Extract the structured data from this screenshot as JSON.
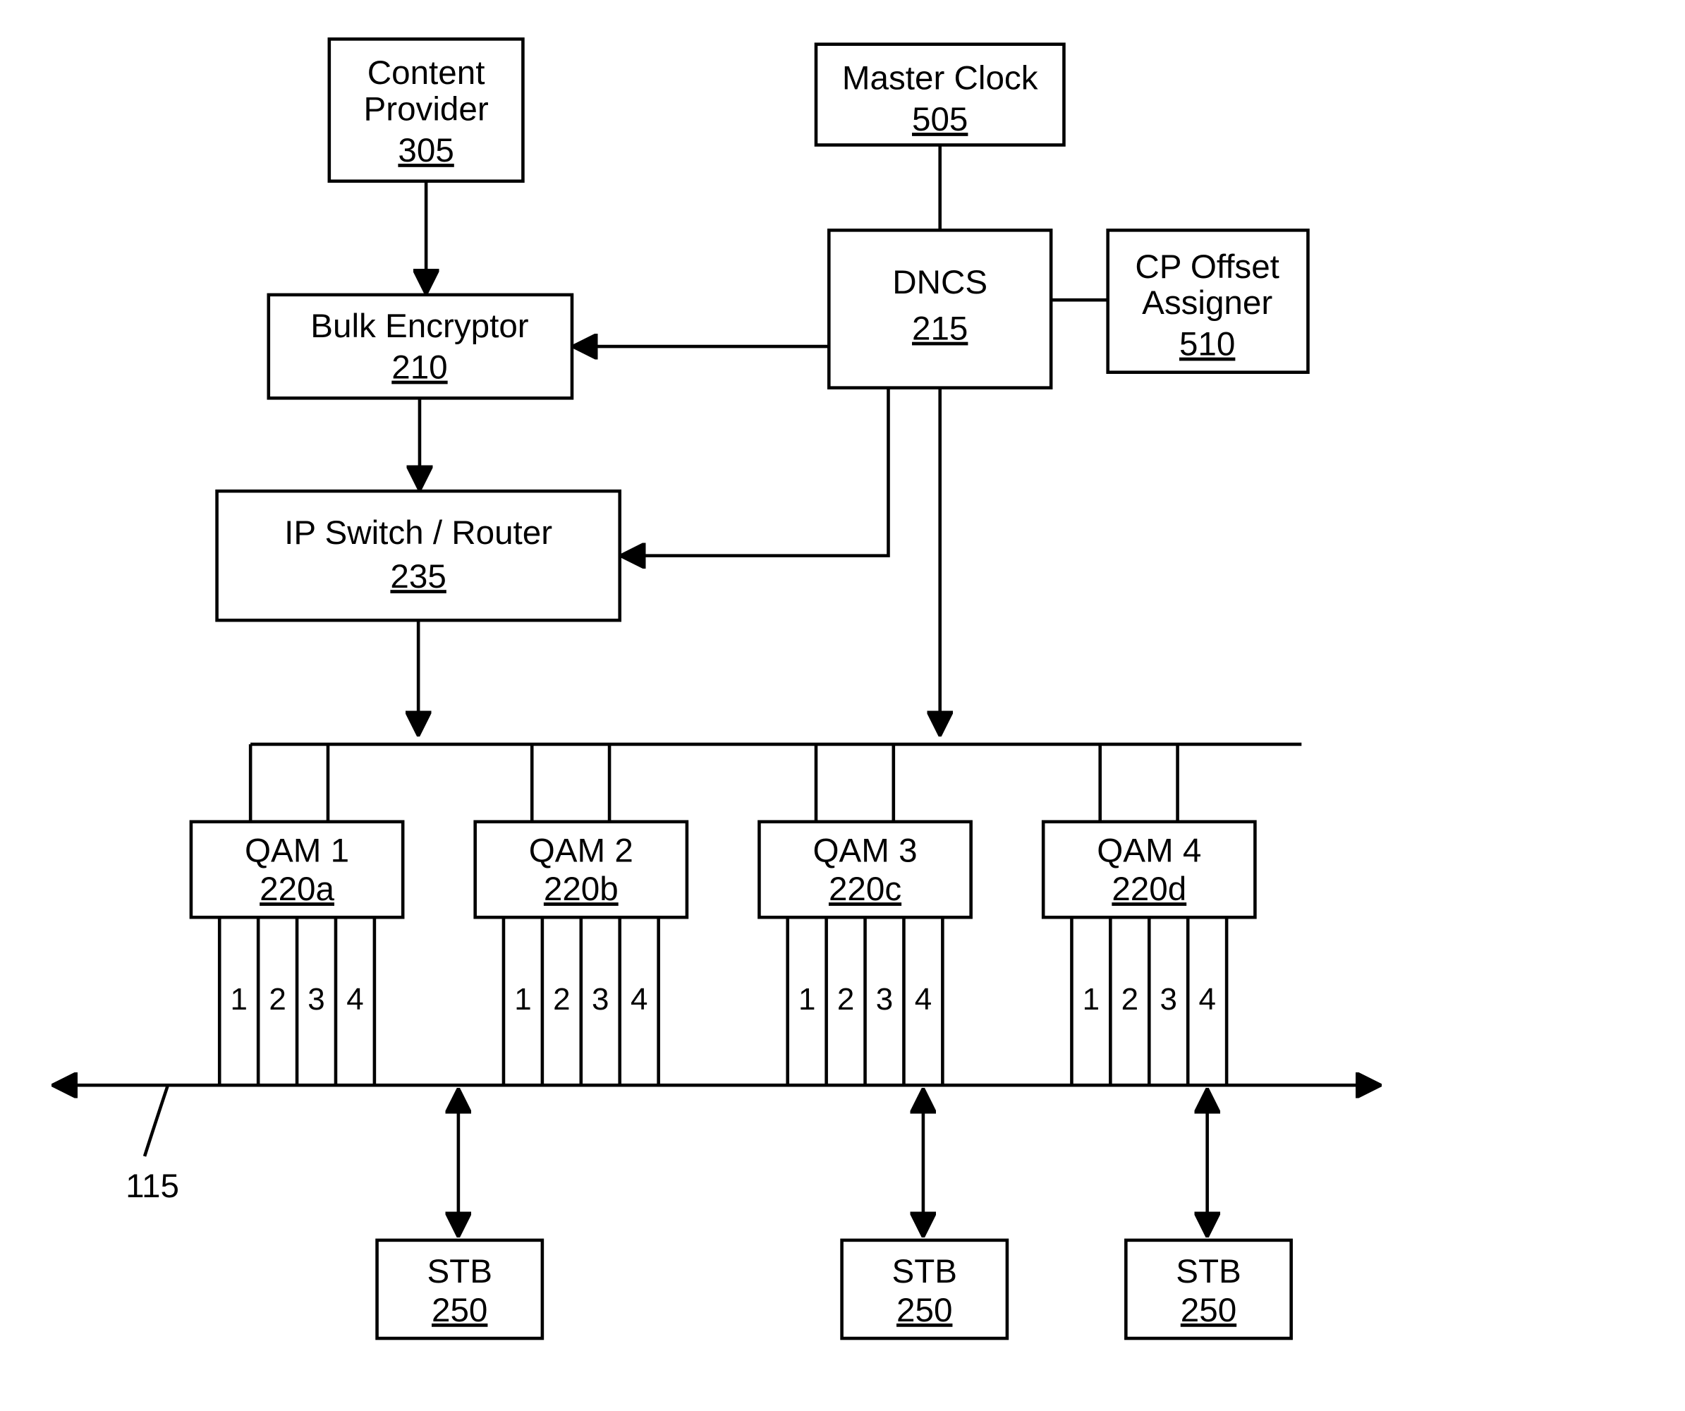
{
  "content_provider": {
    "label": "Content",
    "label2": "Provider",
    "ref": "305"
  },
  "master_clock": {
    "label": "Master Clock",
    "ref": "505"
  },
  "dncs": {
    "label": "DNCS",
    "ref": "215"
  },
  "cp_offset": {
    "label": "CP Offset",
    "label2": "Assigner",
    "ref": "510"
  },
  "bulk_encryptor": {
    "label": "Bulk Encryptor",
    "ref": "210"
  },
  "ip_switch": {
    "label": "IP Switch / Router",
    "ref": "235"
  },
  "qam1": {
    "label": "QAM 1",
    "ref": "220a"
  },
  "qam2": {
    "label": "QAM 2",
    "ref": "220b"
  },
  "qam3": {
    "label": "QAM 3",
    "ref": "220c"
  },
  "qam4": {
    "label": "QAM 4",
    "ref": "220d"
  },
  "port1": "1",
  "port2": "2",
  "port3": "3",
  "port4": "4",
  "stb1": {
    "label": "STB",
    "ref": "250"
  },
  "stb2": {
    "label": "STB",
    "ref": "250"
  },
  "stb3": {
    "label": "STB",
    "ref": "250"
  },
  "bus_ref": "115"
}
